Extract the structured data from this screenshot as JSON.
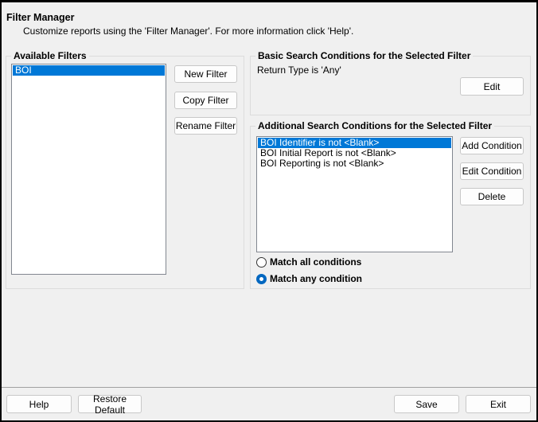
{
  "header": {
    "title": "Filter Manager",
    "subtitle": "Customize reports using the 'Filter Manager'. For more information click 'Help'."
  },
  "available": {
    "label": "Available Filters",
    "items": [
      {
        "label": "BOI",
        "selected": true
      }
    ],
    "new_label": "New Filter",
    "copy_label": "Copy Filter",
    "rename_label": "Rename Filter"
  },
  "basic": {
    "label": "Basic Search Conditions for the Selected Filter",
    "text": "Return Type is 'Any'",
    "edit_label": "Edit"
  },
  "additional": {
    "label": "Additional Search Conditions for the Selected Filter",
    "items": [
      {
        "label": "BOI Identifier is not <Blank>",
        "selected": true
      },
      {
        "label": "BOI Initial Report is not <Blank>"
      },
      {
        "label": "BOI Reporting is not <Blank>"
      }
    ],
    "add_label": "Add Condition",
    "edit_label": "Edit Condition",
    "delete_label": "Delete",
    "match_all": "Match all conditions",
    "match_any": "Match any condition",
    "match_selected": "any"
  },
  "footer": {
    "help": "Help",
    "restore": "Restore Default",
    "save": "Save",
    "exit": "Exit"
  },
  "colors": {
    "selection": "#0078d7",
    "background": "#f0f0f0"
  }
}
